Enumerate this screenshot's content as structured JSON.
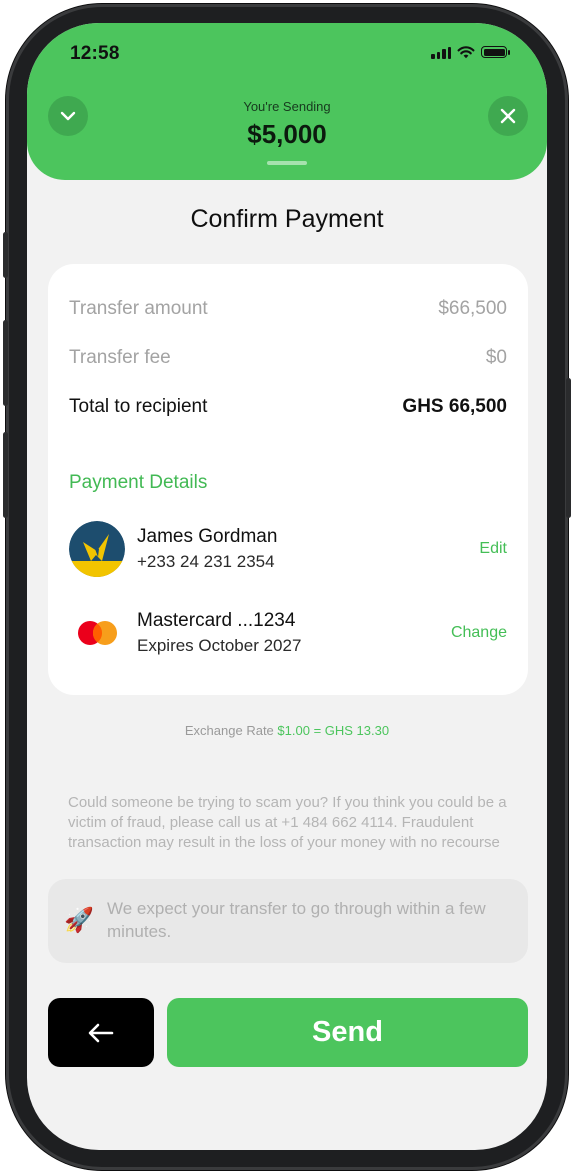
{
  "status_bar": {
    "time": "12:58"
  },
  "header": {
    "sending_label": "You're Sending",
    "sending_amount": "$5,000",
    "left_icon": "chevron-down-icon",
    "right_icon": "close-icon",
    "accent_color": "#4CC55D"
  },
  "title": "Confirm Payment",
  "summary": [
    {
      "label": "Transfer amount",
      "value": "$66,500"
    },
    {
      "label": "Transfer fee",
      "value": "$0"
    },
    {
      "label": "Total to recipient",
      "value": "GHS 66,500"
    }
  ],
  "payment_details": {
    "title": "Payment Details",
    "recipient": {
      "name": "James Gordman",
      "phone": "+233 24 231 2354",
      "action": "Edit"
    },
    "card": {
      "name": "Mastercard ...1234",
      "expiry": "Expires October 2027",
      "action": "Change"
    }
  },
  "exchange_rate": {
    "label": "Exchange Rate",
    "value": "$1.00 = GHS 13.30"
  },
  "warning": "Could someone be trying to scam you? If you think you could be a victim of fraud, please call us at +1 484 662 4114. Fraudulent transaction may result in the loss of your money with no recourse",
  "eta": {
    "icon": "rocket-icon",
    "text": "We expect your transfer to go through within a few minutes."
  },
  "buttons": {
    "back_icon": "arrow-left-icon",
    "send": "Send"
  }
}
